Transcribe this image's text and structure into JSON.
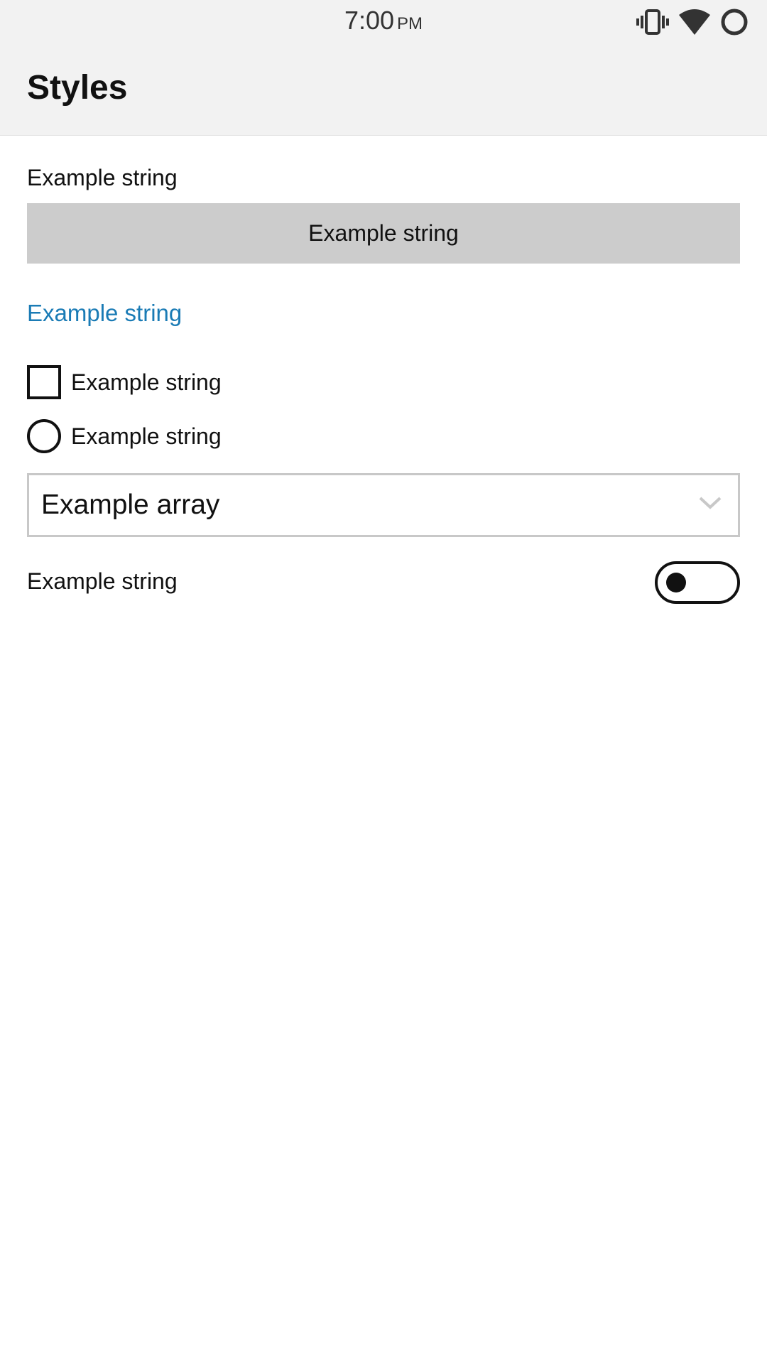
{
  "status_bar": {
    "time": "7:00",
    "ampm": "PM",
    "icons": [
      "vibrate-icon",
      "wifi-icon",
      "battery-circle-icon"
    ]
  },
  "header": {
    "title": "Styles"
  },
  "content": {
    "text_label": "Example string",
    "button_label": "Example string",
    "link_label": "Example string",
    "checkbox": {
      "label": "Example string",
      "checked": false
    },
    "radio": {
      "label": "Example string",
      "selected": false
    },
    "dropdown": {
      "selected": "Example array"
    },
    "switch": {
      "label": "Example string",
      "on": false
    }
  },
  "colors": {
    "appbar_bg": "#f2f2f2",
    "button_bg": "#cccccc",
    "link": "#1a7bb5",
    "text": "#111111"
  }
}
